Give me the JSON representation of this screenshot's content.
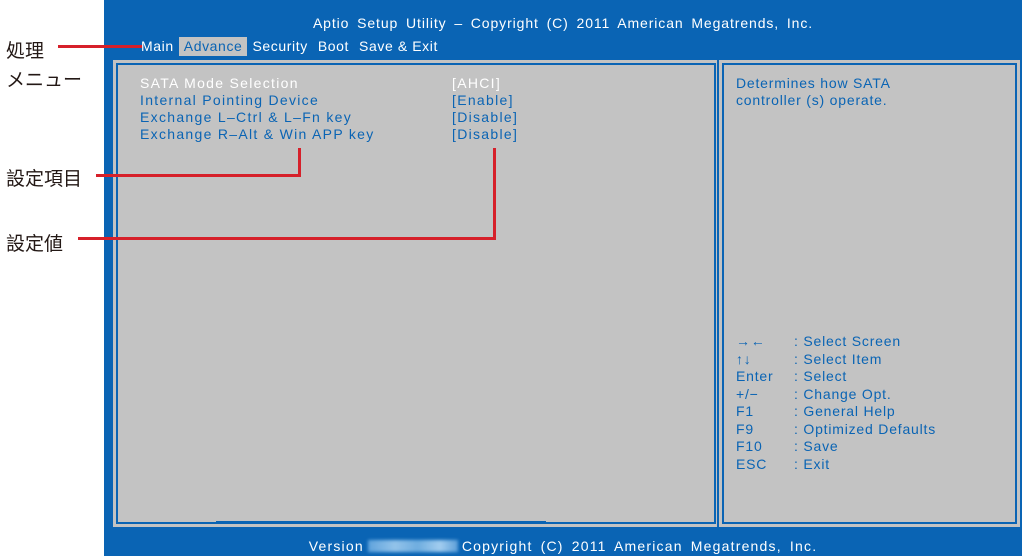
{
  "title_bar": "Aptio Setup Utility – Copyright (C) 2011 American Megatrends, Inc.",
  "menu": {
    "items": [
      {
        "label": "Main",
        "active": false
      },
      {
        "label": "Advance",
        "active": true
      },
      {
        "label": "Security",
        "active": false
      },
      {
        "label": "Boot",
        "active": false
      },
      {
        "label": "Save & Exit",
        "active": false
      }
    ]
  },
  "settings": [
    {
      "label": "SATA Mode Selection",
      "value": "[AHCI]",
      "selected": true
    },
    {
      "label": "Internal Pointing Device",
      "value": "[Enable]",
      "selected": false
    },
    {
      "label": "Exchange L–Ctrl & L–Fn key",
      "value": "[Disable]",
      "selected": false
    },
    {
      "label": "Exchange R–Alt & Win APP key",
      "value": "[Disable]",
      "selected": false
    }
  ],
  "help": {
    "line1": "Determines how SATA",
    "line2": "controller (s) operate."
  },
  "keys": [
    {
      "key": "→←",
      "desc": ": Select Screen"
    },
    {
      "key": "↑↓",
      "desc": ": Select Item"
    },
    {
      "key": "Enter",
      "desc": ": Select"
    },
    {
      "key": "+/−",
      "desc": ": Change Opt."
    },
    {
      "key": "F1",
      "desc": ": General Help"
    },
    {
      "key": "F9",
      "desc": ": Optimized Defaults"
    },
    {
      "key": "F10",
      "desc": ": Save"
    },
    {
      "key": "ESC",
      "desc": ": Exit"
    }
  ],
  "footer": {
    "version_label": "Version",
    "copyright": "Copyright (C) 2011 American Megatrends, Inc."
  },
  "annotations": {
    "menu_line1": "処理",
    "menu_line2": "メニュー",
    "setting_item": "設定項目",
    "setting_value": "設定値"
  },
  "colors": {
    "bios_blue": "#0a64b4",
    "panel_gray": "#c3c3c3",
    "leader_red": "#d6202a"
  }
}
